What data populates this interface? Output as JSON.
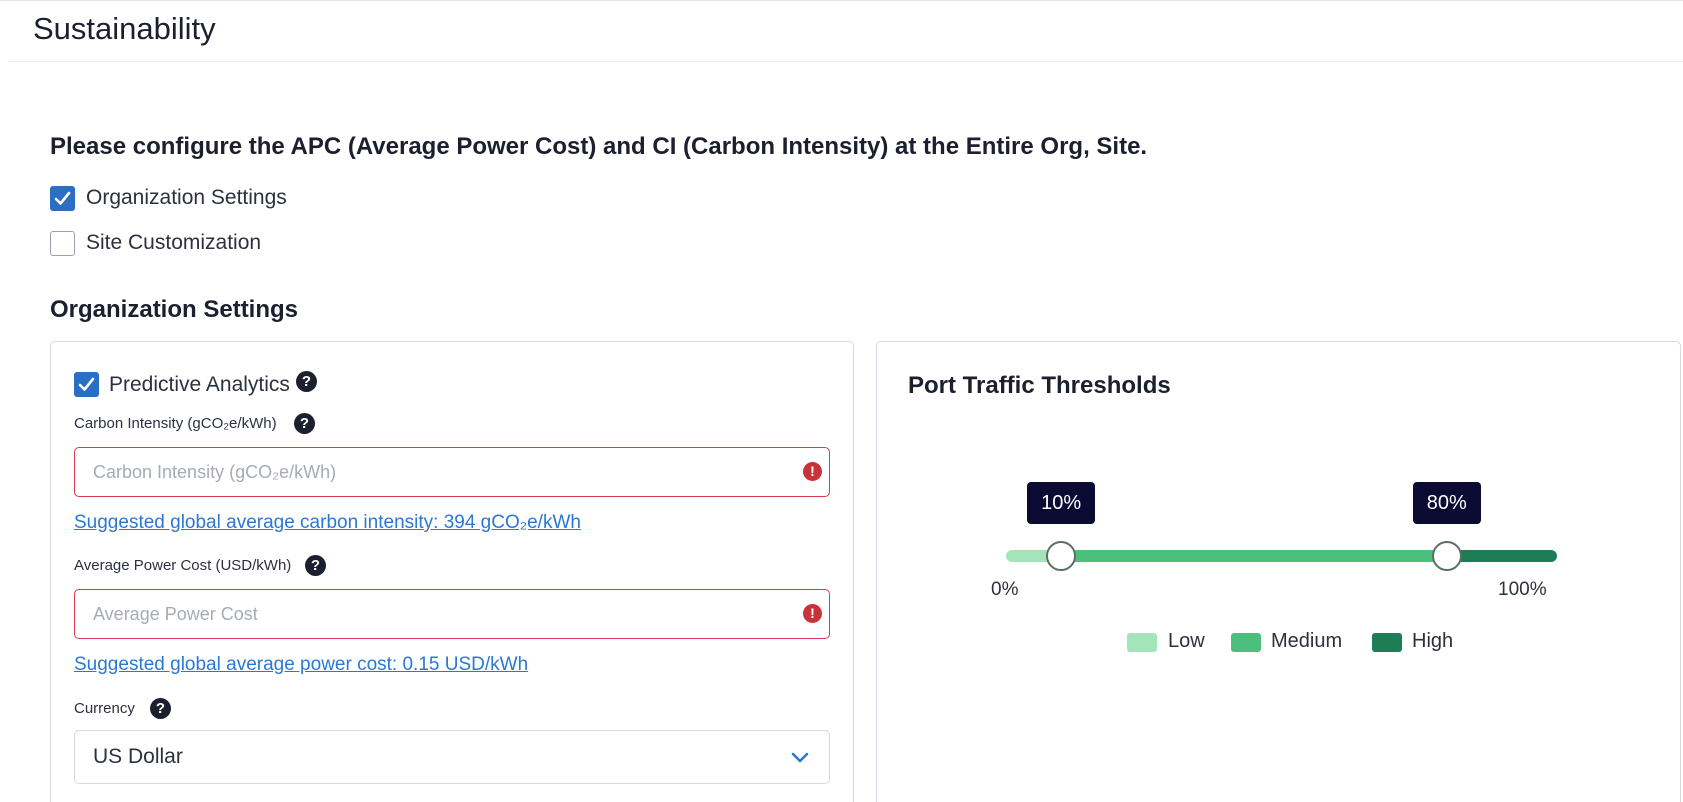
{
  "page": {
    "title": "Sustainability"
  },
  "intro_text": "Please configure the APC (Average Power Cost) and CI (Carbon Intensity) at the Entire Org, Site.",
  "scope_options": [
    {
      "label": "Organization Settings",
      "checked": true
    },
    {
      "label": "Site Customization",
      "checked": false
    }
  ],
  "section_title": "Organization Settings",
  "org_settings": {
    "predictive_analytics": {
      "label": "Predictive Analytics",
      "checked": true
    },
    "carbon_intensity": {
      "label": "Carbon Intensity (gCO₂e/kWh)",
      "value": "",
      "placeholder": "Carbon Intensity (gCO₂e/kWh)",
      "suggestion": "Suggested global average carbon intensity: 394 gCO₂e/kWh"
    },
    "power_cost": {
      "label": "Average Power Cost (USD/kWh)",
      "value": "",
      "placeholder": "Average Power Cost",
      "suggestion": "Suggested global average power cost: 0.15 USD/kWh"
    },
    "currency": {
      "label": "Currency",
      "selected": "US Dollar"
    }
  },
  "port_traffic": {
    "title": "Port Traffic Thresholds",
    "low_threshold": 10,
    "high_threshold": 80,
    "low_label": "10%",
    "high_label": "80%",
    "min_label": "0%",
    "max_label": "100%",
    "legend": [
      {
        "label": "Low",
        "color": "#a3e4bb"
      },
      {
        "label": "Medium",
        "color": "#4bbf7c"
      },
      {
        "label": "High",
        "color": "#1e7d55"
      }
    ]
  },
  "colors": {
    "accent": "#2b6fc4",
    "link": "#2b78d4",
    "error": "#c8323a",
    "badge": "#0b0a33"
  },
  "icons": [
    "checkmark-icon",
    "help-icon",
    "error-icon",
    "chevron-down-icon"
  ]
}
